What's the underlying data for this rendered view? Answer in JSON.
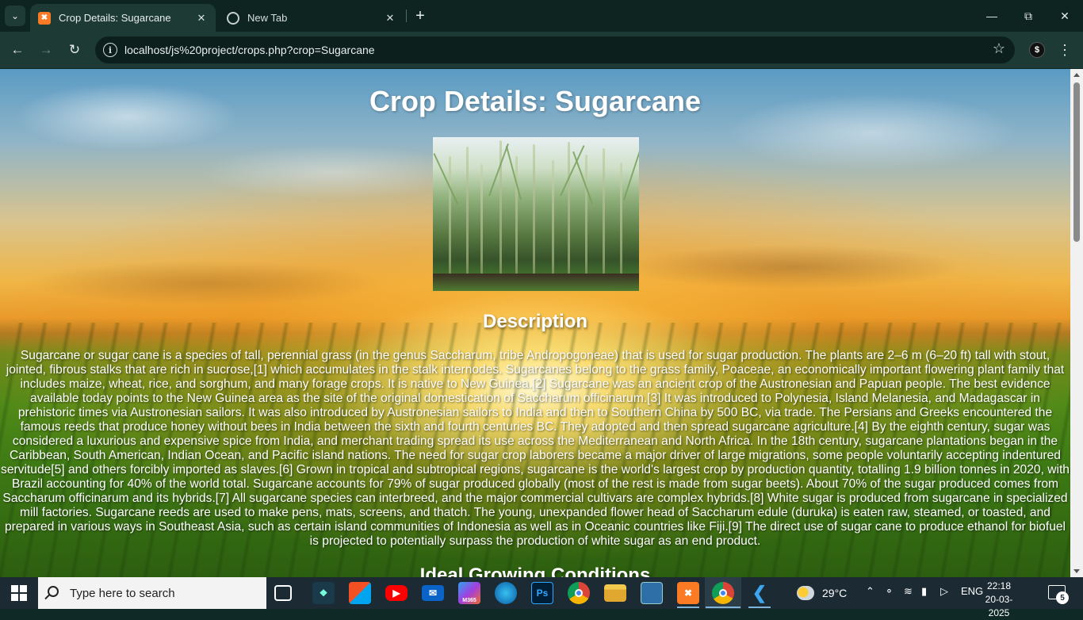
{
  "browser": {
    "tabs": [
      {
        "title": "Crop Details: Sugarcane",
        "favicon": "xampp-icon",
        "active": true
      },
      {
        "title": "New Tab",
        "favicon": "chrome-icon",
        "active": false
      }
    ],
    "new_tab_symbol": "+",
    "url": "localhost/js%20project/crops.php?crop=Sugarcane"
  },
  "page": {
    "title": "Crop Details: Sugarcane",
    "image_alt": "Sugarcane",
    "description_heading": "Description",
    "description": "Sugarcane or sugar cane is a species of tall, perennial grass (in the genus Saccharum, tribe Andropogoneae) that is used for sugar production. The plants are 2–6 m (6–20 ft) tall with stout, jointed, fibrous stalks that are rich in sucrose,[1] which accumulates in the stalk internodes. Sugarcanes belong to the grass family, Poaceae, an economically important flowering plant family that includes maize, wheat, rice, and sorghum, and many forage crops. It is native to New Guinea.[2] Sugarcane was an ancient crop of the Austronesian and Papuan people. The best evidence available today points to the New Guinea area as the site of the original domestication of Saccharum officinarum.[3] It was introduced to Polynesia, Island Melanesia, and Madagascar in prehistoric times via Austronesian sailors. It was also introduced by Austronesian sailors to India and then to Southern China by 500 BC, via trade. The Persians and Greeks encountered the famous reeds that produce honey without bees in India between the sixth and fourth centuries BC. They adopted and then spread sugarcane agriculture.[4] By the eighth century, sugar was considered a luxurious and expensive spice from India, and merchant trading spread its use across the Mediterranean and North Africa. In the 18th century, sugarcane plantations began in the Caribbean, South American, Indian Ocean, and Pacific island nations. The need for sugar crop laborers became a major driver of large migrations, some people voluntarily accepting indentured servitude[5] and others forcibly imported as slaves.[6] Grown in tropical and subtropical regions, sugarcane is the world's largest crop by production quantity, totalling 1.9 billion tonnes in 2020, with Brazil accounting for 40% of the world total. Sugarcane accounts for 79% of sugar produced globally (most of the rest is made from sugar beets). About 70% of the sugar produced comes from Saccharum officinarum and its hybrids.[7] All sugarcane species can interbreed, and the major commercial cultivars are complex hybrids.[8] White sugar is produced from sugarcane in specialized mill factories. Sugarcane reeds are used to make pens, mats, screens, and thatch. The young, unexpanded flower head of Saccharum edule (duruka) is eaten raw, steamed, or toasted, and prepared in various ways in Southeast Asia, such as certain island communities of Indonesia as well as in Oceanic countries like Fiji.[9] The direct use of sugar cane to produce ethanol for biofuel is projected to potentially surpass the production of white sugar as an end product.",
    "conditions_heading": "Ideal Growing Conditions"
  },
  "taskbar": {
    "search_placeholder": "Type here to search",
    "apps": [
      "task-view-icon",
      "xampp-control-icon",
      "microsoft-store-icon",
      "youtube-icon",
      "mail-icon",
      "m365-icon",
      "edge-icon",
      "photoshop-icon",
      "chrome-icon",
      "file-explorer-icon",
      "remote-desktop-icon",
      "xampp-icon",
      "chrome-profile-icon",
      "vscode-icon"
    ],
    "m365_label": "M365",
    "ps_label": "Ps",
    "weather_temp": "29°C",
    "language": "ENG",
    "time": "22:18",
    "date": "20-03-2025",
    "notification_count": "5"
  },
  "colors": {
    "chrome_dark": "#0d2420",
    "chrome_toolbar": "#1d3a35",
    "taskbar": "#1c2b33",
    "page_text": "#ffffff"
  }
}
